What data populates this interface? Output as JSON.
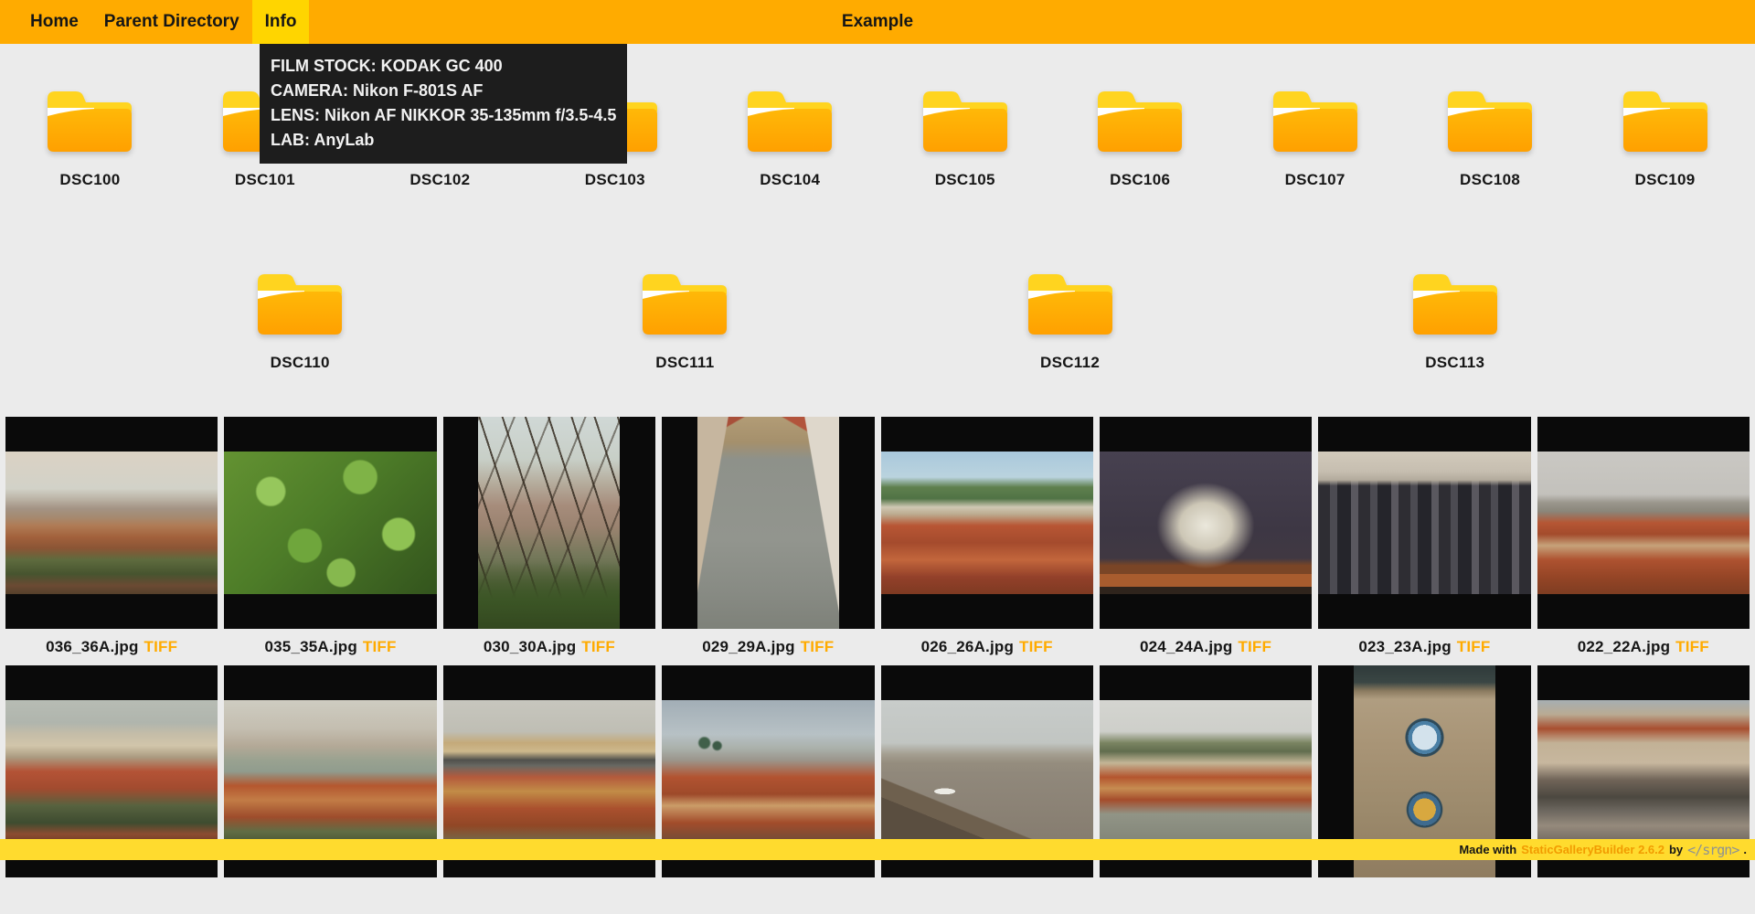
{
  "nav": {
    "items": [
      {
        "label": "Home",
        "active": false
      },
      {
        "label": "Parent Directory",
        "active": false
      },
      {
        "label": "Info",
        "active": true
      }
    ],
    "title": "Example"
  },
  "tooltip": {
    "lines": [
      "FILM STOCK: KODAK GC 400",
      "CAMERA: Nikon F-801S AF",
      "LENS: Nikon AF NIKKOR 35-135mm f/3.5-4.5",
      "LAB: AnyLab"
    ]
  },
  "folders": {
    "names": [
      "DSC100",
      "DSC101",
      "DSC102",
      "DSC103",
      "DSC104",
      "DSC105",
      "DSC106",
      "DSC107",
      "DSC108",
      "DSC109",
      "DSC110",
      "DSC111",
      "DSC112",
      "DSC113"
    ]
  },
  "images": {
    "items": [
      {
        "label": "036_36A.jpg",
        "tag": "TIFF",
        "fit": "landscape",
        "photo": "linear-gradient(180deg,#dbd2c4 0%,#d2d2c8 26%,#b9b0a2 34%,#a39384 40%,#a58a70 46%,#b07b55 52%,#a2613c 60%,#8a5535 68%,#5e6b3e 76%,#47542f 86%,#6b4a33 94%,#55402b 100%)"
      },
      {
        "label": "035_35A.jpg",
        "tag": "TIFF",
        "fit": "landscape",
        "photo": "radial-gradient(circle at 22% 28%,#96c75c 0 7%,rgba(0,0,0,0) 8%),radial-gradient(circle at 64% 18%,#7fb347 0 9%,rgba(0,0,0,0) 10%),radial-gradient(circle at 82% 58%,#8fc253 0 8%,rgba(0,0,0,0) 9%),radial-gradient(circle at 38% 66%,#6fa63c 0 10%,rgba(0,0,0,0) 11%),radial-gradient(circle at 55% 85%,#86b84e 0 8%,rgba(0,0,0,0) 9%),linear-gradient(135deg,#639232 0%,#4d7c28 45%,#33541d 100%)"
      },
      {
        "label": "030_30A.jpg",
        "tag": "TIFF",
        "fit": "portrait",
        "photo": "linear-gradient(0deg,#33481f 0%,#3c5626 14%,rgba(60,86,38,0) 32%),repeating-linear-gradient(72deg,rgba(54,45,34,0.85) 0 2px,rgba(0,0,0,0) 2px 24px),repeating-linear-gradient(112deg,rgba(54,45,34,0.55) 0 2px,rgba(0,0,0,0) 2px 36px),linear-gradient(180deg,#d0d8d6 0%,#c8cfc7 20%,#b4aa9a 32%,#a68c7b 42%,#9a8370 52%,#74785a 66%,#55613c 82%,#3f512c 100%)"
      },
      {
        "label": "029_29A.jpg",
        "tag": "TIFF",
        "fit": "portrait",
        "photo": "linear-gradient(100deg,#c6b69f 0 17%,rgba(0,0,0,0) 17.5%),linear-gradient(260deg,#ded7cb 0 19%,rgba(0,0,0,0) 19.5%),linear-gradient(210deg,#b2543c 0 11%,rgba(0,0,0,0) 11.5%),linear-gradient(150deg,#a8503a 0 9%,rgba(0,0,0,0) 9.5%),linear-gradient(180deg,#b29c76 0%,#a5906c 12%,#8e918a 20%,#92958e 58%,#878a83 84%,#7e8179 100%)"
      },
      {
        "label": "026_26A.jpg",
        "tag": "TIFF",
        "fit": "landscape",
        "photo": "linear-gradient(180deg,#a9c8dc 0%,#bad3de 18%,#5f804e 25%,#507345 33%,#cfc7b3 39%,#bcab8f 44%,#b85634 52%,#a54b2d 64%,#c2663c 76%,#93402a 88%,#7e3a22 100%)"
      },
      {
        "label": "024_24A.jpg",
        "tag": "TIFF",
        "fit": "landscape",
        "photo": "radial-gradient(ellipse 32% 42% at 50% 52%,#ebe8dc 0%,#cdc7b6 38%,rgba(70,64,76,0) 72%),linear-gradient(0deg,#2f241c 0 5%,#a85c2e 5% 14%,#7a4526 14% 20%,rgba(0,0,0,0) 25%),linear-gradient(180deg,#474150 0%,#3d3744 55%,#453a40 100%)"
      },
      {
        "label": "023_23A.jpg",
        "tag": "TIFF",
        "fit": "landscape",
        "photo": "linear-gradient(180deg,#d2cabb 0%,#c6beb0 14%,#b3aa9c 20%,rgba(0,0,0,0) 24%),repeating-linear-gradient(90deg,#2e2d33 0 13px,#4c4b52 13px 21px,#25252b 21px 36px,#5a585f 36px 44px),linear-gradient(180deg,rgba(0,0,0,0) 0%,rgba(0,0,0,0) 34%,rgba(158,154,146,0.55) 72%,#a8a49c 100%)"
      },
      {
        "label": "022_22A.jpg",
        "tag": "TIFF",
        "fit": "landscape",
        "photo": "linear-gradient(180deg,#cac8c3 0%,#c3c1bc 30%,#9a968c 36%,#8a867a 42%,#b65634 50%,#a34b2c 58%,#c6a27a 66%,#ae5230 76%,#954526 88%,#7e3d22 100%)"
      },
      {
        "fit": "landscape",
        "photo": "linear-gradient(180deg,#b7bcb4 0%,#b0b5ad 16%,#c5bda8 24%,#d1c5aa 32%,#ab9b81 40%,#b45336 50%,#a24b2f 62%,#57623f 74%,#3e4c30 86%,#8c4c31 94%,#6e3d27 100%)"
      },
      {
        "fit": "landscape",
        "photo": "linear-gradient(180deg,#ceccc1 0%,#c4beb0 20%,#b4a997 32%,#9aa290 42%,#909c8e 50%,#b4572f 60%,#c27c46 70%,#9e4c2c 82%,#616d44 92%,#4c5836 100%)"
      },
      {
        "fit": "landscape",
        "photo": "linear-gradient(180deg,#c7c6be 0%,#bfbeb4 22%,#c4aa7a 30%,#cdb88c 36%,#50504c 42%,#686862 46%,#b45a3c 54%,#c28c47 64%,#aa502e 76%,#914726 88%,#716c4c 100%)"
      },
      {
        "fit": "landscape",
        "photo": "radial-gradient(circle at 20% 30%,#40604a 0 2.5%,rgba(0,0,0,0) 3.5%),radial-gradient(circle at 26% 32%,#3c5a46 0 2%,rgba(0,0,0,0) 3%),linear-gradient(180deg,#a2aeb6 0%,#b7c1c5 24%,#aab0aa 34%,#9b968c 42%,#b25331 54%,#9e4a2a 66%,#cb9c68 74%,#a24c2b 86%,#6e4c38 100%)"
      },
      {
        "fit": "landscape",
        "photo": "radial-gradient(ellipse 7% 3% at 30% 64%,#ecebe5 0 70%,rgba(0,0,0,0) 72%),linear-gradient(22deg,#5a4e40 0 20%,#6e604e 20% 28%,rgba(0,0,0,0) 28.5%),linear-gradient(180deg,#c8ccca 0%,#c1c5c2 30%,#a49e90 38%,#958d7e 44%,#90887b 52%,#8c8376 72%,#857c6f 100%)"
      },
      {
        "fit": "landscape",
        "photo": "linear-gradient(180deg,#d4d5d0 0%,#cecfca 22%,#7a8461 30%,#616d4e 36%,#c3b596 44%,#b4552f 54%,#c68c51 62%,#a54d2c 70%,#919486 80%,#828578 100%)"
      },
      {
        "fit": "portrait",
        "photo": "radial-gradient(circle at 50% 34%,#d3e2ec 0 8%,#4a7fa5 8% 10.5%,#2e4a5a 10.5% 12%,rgba(0,0,0,0) 12.5%),radial-gradient(circle at 50% 68%,#d8a83f 0 7%,#3f6b8e 7% 10%,#2e4a5a 10% 11%,rgba(0,0,0,0) 11.5%),linear-gradient(180deg,#2f3a3a 0%,#3a4644 8%,#8a7a5f 12%,rgba(0,0,0,0) 16%),linear-gradient(180deg,#b5a488 0%,#a89476 38%,#9c8a6c 68%,#8f7c60 100%)"
      },
      {
        "fit": "landscape",
        "photo": "linear-gradient(180deg,#a6aeb2 0%,#b9ab93 10%,#a84f30 20%,#c2b196 30%,#c7b79e 44%,#706458 56%,#4c4840 68%,#6e6860 78%,#958a7c 88%,#716960 100%)"
      }
    ]
  },
  "footer": {
    "prefix": "Made with",
    "builder": "StaticGalleryBuilder 2.6.2",
    "by": "by",
    "logo": "</srgn>",
    "suffix": "."
  },
  "colors": {
    "nav_orange": "#FFAB00",
    "active_yellow": "#FFD500",
    "footer_yellow": "#FFDB2E",
    "tag_orange": "#FFAB00",
    "tooltip_bg": "#1D1D1D",
    "page_bg": "#EBEBEB",
    "cell_black": "#0A0A0A"
  }
}
